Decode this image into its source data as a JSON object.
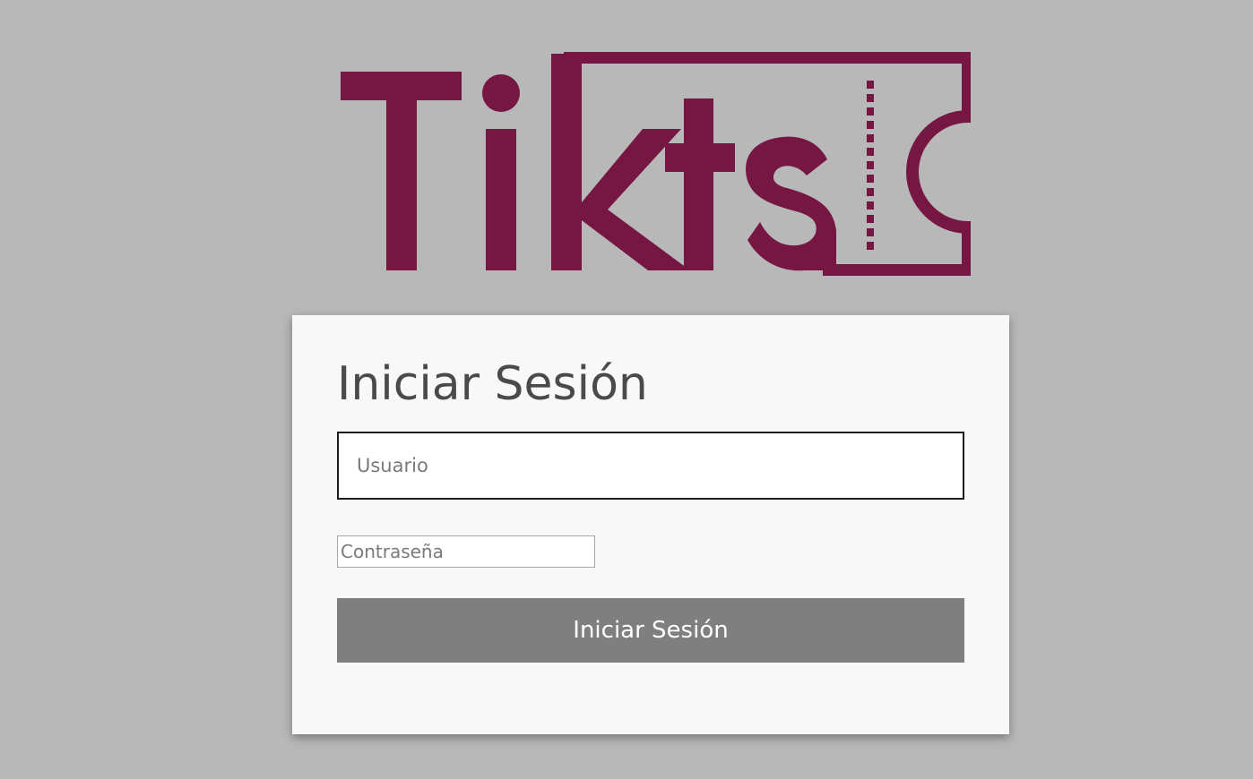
{
  "logo": {
    "text": "Tikts",
    "icon": "ticket-icon",
    "color": "#761642"
  },
  "login": {
    "title": "Iniciar Sesión",
    "username_placeholder": "Usuario",
    "username_value": "",
    "password_placeholder": "Contraseña",
    "password_value": "",
    "submit_label": "Iniciar Sesión"
  },
  "colors": {
    "background": "#b8b8b8",
    "card": "#f8f8f8",
    "button": "#7f7f7f",
    "brand": "#761642"
  }
}
